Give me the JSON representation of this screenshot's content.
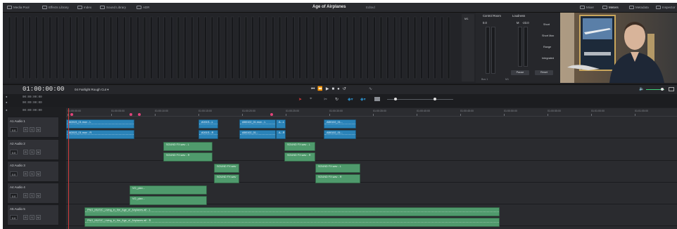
{
  "project": {
    "title": "Age of Airplanes",
    "edit_label": "Edited"
  },
  "topbar": {
    "left_tabs": [
      "Media Pool",
      "Effects Library",
      "Index",
      "Sound Library",
      "ADR"
    ],
    "right_tabs": [
      "Mixer",
      "Meters",
      "Metadata",
      "Inspector"
    ]
  },
  "meters": {
    "control_room_label": "Control Room",
    "loudness_label": "Loudness",
    "control_value": "0.0",
    "loudness_m": "M",
    "loudness_value": "-23.0",
    "items": [
      "Short",
      "Short Max",
      "Range",
      "Integrated"
    ],
    "pause_label": "Pause",
    "reset_label": "Reset",
    "bus_label": "Bus 1",
    "m1_label": "M1"
  },
  "timecode": "01:00:00:00",
  "sequence_name": "04 Fairlight Rough Cut",
  "tc_rows": [
    "00:00:00:00",
    "00:00:00:00",
    "00:00:00:00"
  ],
  "ruler_ticks": [
    "01:00:00:00",
    "01:00:05:00",
    "01:00:10:00",
    "01:00:15:00",
    "01:00:20:00",
    "01:00:25:00",
    "01:00:30:00",
    "01:00:35:00",
    "01:00:40:00",
    "01:00:45:00",
    "01:00:50:00",
    "01:00:55:00",
    "01:01:00:00",
    "01:01:05:00"
  ],
  "tracks": [
    {
      "id": "A1",
      "name": "Audio 1",
      "vol": "0.0"
    },
    {
      "id": "A2",
      "name": "Audio 2",
      "vol": "0.0"
    },
    {
      "id": "A3",
      "name": "Audio 3",
      "vol": "0.0"
    },
    {
      "id": "A4",
      "name": "Audio 4",
      "vol": "0.0"
    },
    {
      "id": "A5",
      "name": "Audio 5",
      "vol": "0.0"
    }
  ],
  "track_buttons": [
    "R",
    "S",
    "M"
  ],
  "clips": {
    "a1": [
      "A001S_01.mov - L",
      "A001S_01.mov - R",
      "A001S...L",
      "A001S...R",
      "AB0102_01.mov - L",
      "AB0102_01...",
      "A...L",
      "A...R",
      "AB0102_01...",
      "AB0102_01..."
    ],
    "a2": [
      "SOUND FX.wav - L",
      "SOUND FX.wav - R",
      "SOUND FX.wav - L",
      "SOUND FX.wav - R"
    ],
    "a3": [
      "SOUND FX.wav",
      "SOUND FX.wav",
      "SOUND FX.wav - L",
      "SOUND FX.wav - R"
    ],
    "a4": [
      "VO_plan...",
      "VO_plan..."
    ],
    "a5": [
      "PNG_MUSIC_Living_in_the_Age_of_Airplanes.aif - L",
      "PNG_MUSIC_Living_in_the_Age_of_Airplanes.aif - R"
    ]
  },
  "colors": {
    "clip_blue": "#2a83b8",
    "clip_green": "#4f9a6c",
    "playhead": "#d33b3b"
  }
}
